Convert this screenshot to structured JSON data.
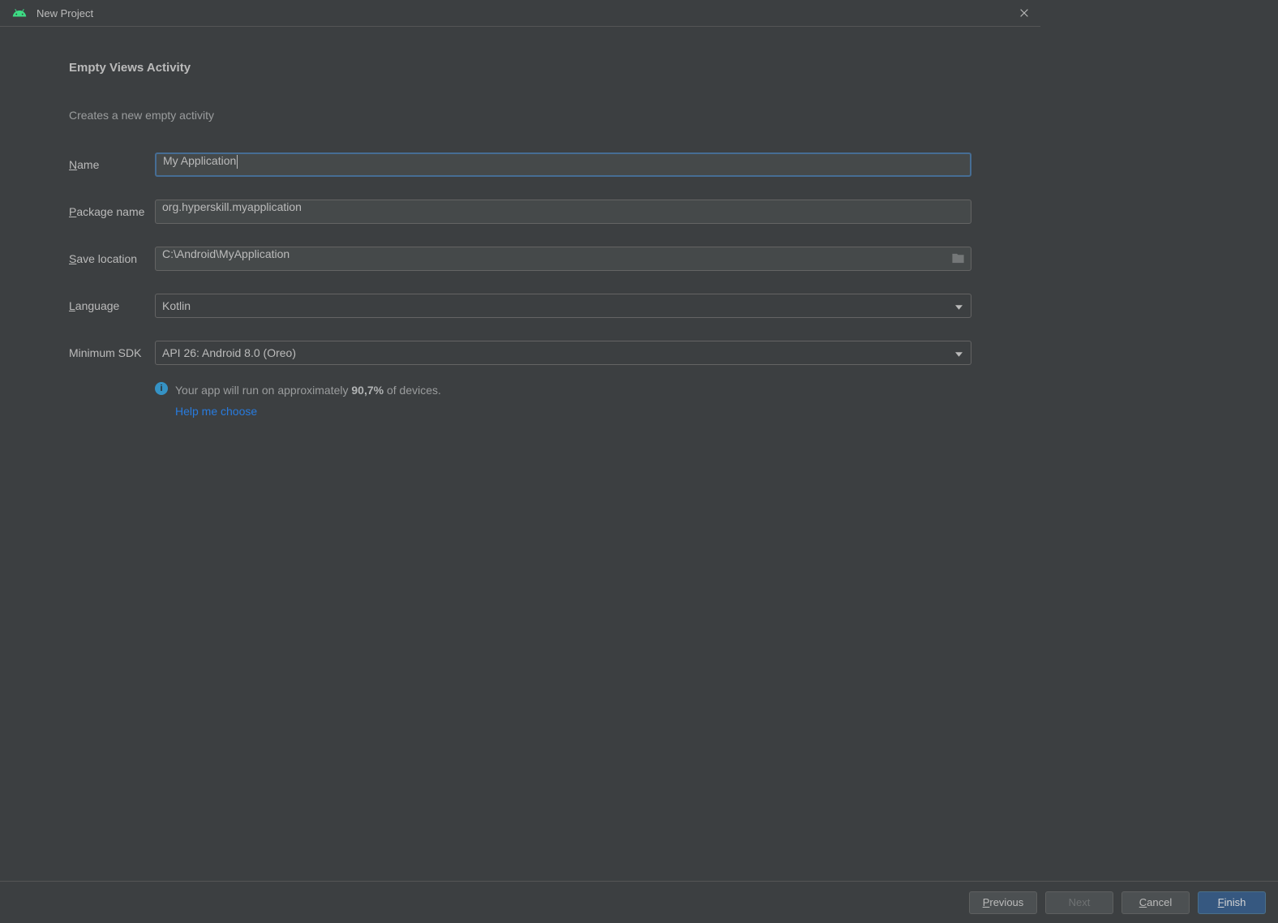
{
  "window": {
    "title": "New Project"
  },
  "heading": "Empty Views Activity",
  "description": "Creates a new empty activity",
  "fields": {
    "name": {
      "label": "Name",
      "mnemonic": "N",
      "rest": "ame",
      "value": "My Application"
    },
    "package": {
      "label": "Package name",
      "mnemonic": "P",
      "rest": "ackage name",
      "value": "org.hyperskill.myapplication"
    },
    "location": {
      "label": "Save location",
      "mnemonic": "S",
      "rest": "ave location",
      "value": "C:\\Android\\MyApplication"
    },
    "language": {
      "label": "Language",
      "mnemonic": "L",
      "rest": "anguage",
      "value": "Kotlin"
    },
    "minsdk": {
      "label": "Minimum SDK",
      "value": "API 26: Android 8.0 (Oreo)"
    }
  },
  "info": {
    "prefix": "Your app will run on approximately ",
    "percent": "90,7%",
    "suffix": " of devices.",
    "help_link": "Help me choose"
  },
  "buttons": {
    "previous": "Previous",
    "next": "Next",
    "cancel": "Cancel",
    "finish": "Finish"
  }
}
